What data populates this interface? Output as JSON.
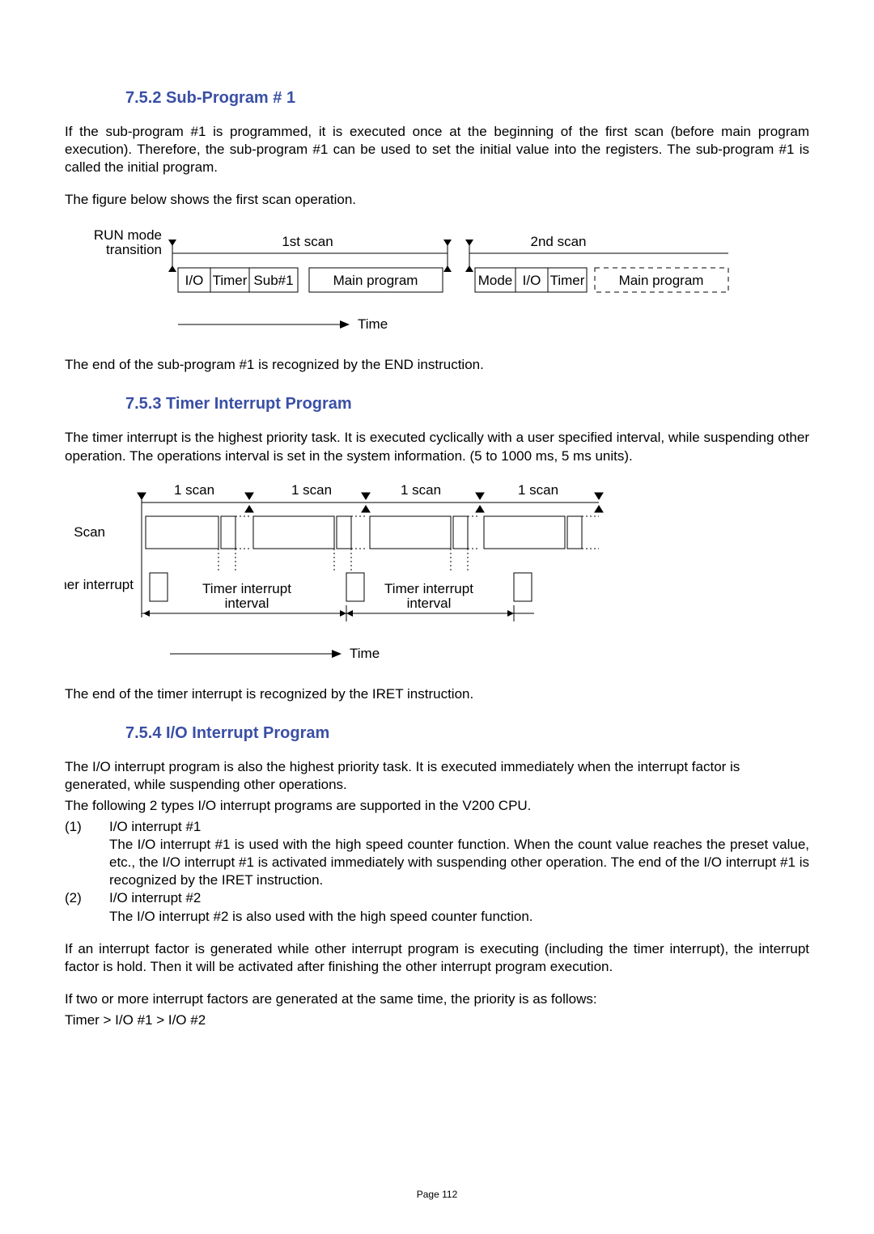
{
  "sec1": {
    "heading": "7.5.2  Sub-Program # 1",
    "p1": "If the sub-program #1 is programmed, it is executed once at the beginning of the first scan (before main program execution).  Therefore, the sub-program #1 can be used to set the initial value into the registers.  The sub-program #1 is called the initial program.",
    "p2": "The figure below shows the first scan operation.",
    "p3": "The end of the sub-program #1 is recognized by the END instruction."
  },
  "fig1": {
    "run_mode": "RUN mode",
    "transition": "transition",
    "scan1": "1st scan",
    "scan2": "2nd scan",
    "io": "I/O",
    "timer": "Timer",
    "sub1": "Sub#1",
    "main": "Main program",
    "mode": "Mode",
    "time": "Time"
  },
  "sec2": {
    "heading": "7.5.3   Timer Interrupt Program",
    "p1": "The timer interrupt is the highest priority task. It is executed cyclically with a user specified interval, while suspending other operation.   The operations interval is set in the system information. (5 to 1000 ms, 5 ms units).",
    "p2": "The end of the timer interrupt is recognized by the IRET instruction."
  },
  "fig2": {
    "one_scan": "1 scan",
    "scan": "Scan",
    "timer_interrupt": "Timer interrupt",
    "interval1": "Timer interrupt",
    "interval2": "interval",
    "time": "Time"
  },
  "sec3": {
    "heading": "7.5.4  I/O Interrupt Program",
    "p1": "The I/O interrupt program is also the highest priority task. It is executed immediately when the interrupt factor is generated, while suspending other operations.",
    "p2": "The following 2 types I/O interrupt programs are supported in the V200 CPU.",
    "item1_num": "(1)",
    "item1_title": "I/O interrupt #1",
    "item1_body": "The I/O interrupt #1 is used with the high speed counter function. When the count value reaches the preset value, etc., the I/O interrupt #1 is activated immediately with suspending other operation. The end of the I/O interrupt #1 is recognized by the IRET instruction.",
    "item2_num": "(2)",
    "item2_title": "I/O interrupt #2",
    "item2_body": "The I/O interrupt #2 is also used with the high speed counter function.",
    "p3": "If an interrupt factor is generated while other interrupt program is executing (including the timer interrupt), the interrupt factor is hold. Then it will be activated after finishing the other interrupt program execution.",
    "p4": "If two or more interrupt factors are generated at the same time, the priority is as follows:",
    "p5": "Timer > I/O #1 > I/O #2"
  },
  "page_num": "Page 112"
}
